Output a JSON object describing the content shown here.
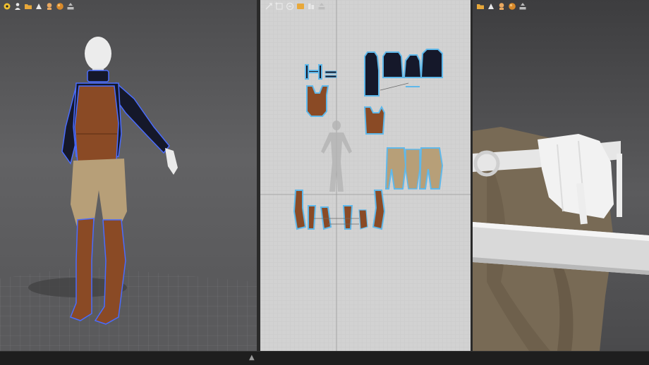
{
  "viewport_3d": {
    "toolbar": [
      {
        "name": "simulation-icon",
        "color": "#f0c030"
      },
      {
        "name": "avatar-icon",
        "color": "#e8e8e8"
      },
      {
        "name": "folder-icon",
        "color": "#e8a83a"
      },
      {
        "name": "garment-icon",
        "color": "#e8e8e8"
      },
      {
        "name": "skin-tone-icon",
        "color": "#e9a860"
      },
      {
        "name": "texture-sphere-icon",
        "color": "#d98a2a"
      },
      {
        "name": "export-icon",
        "color": "#bdbdbd"
      }
    ]
  },
  "pattern_window": {
    "toolbar": [
      {
        "name": "transform-tool-icon",
        "color": "#e8e8e8"
      },
      {
        "name": "edit-point-icon",
        "color": "#e8e8e8"
      },
      {
        "name": "sewing-icon",
        "color": "#e8e8e8"
      },
      {
        "name": "pattern-folder-icon",
        "color": "#e8a83a"
      },
      {
        "name": "grading-icon",
        "color": "#e8e8e8"
      },
      {
        "name": "export-pattern-icon",
        "color": "#bdbdbd"
      }
    ]
  },
  "closeup_viewport": {
    "toolbar": [
      {
        "name": "folder-icon",
        "color": "#e8a83a"
      },
      {
        "name": "garment-icon",
        "color": "#e8e8e8"
      },
      {
        "name": "skin-tone-icon",
        "color": "#e9a860"
      },
      {
        "name": "texture-sphere-icon",
        "color": "#d98a2a"
      },
      {
        "name": "export-icon",
        "color": "#bdbdbd"
      }
    ]
  },
  "colors": {
    "selection_outline": "#4a6cff",
    "pattern_outline": "#5fb8ea",
    "leather": "#8a4a25",
    "trousers": "#b79f78",
    "jacket": "#15182a",
    "skin": "#e9e9e9",
    "grid_bg": "#d2d2d2"
  },
  "bottom_bar": {
    "toggle_glyph": "▲"
  }
}
